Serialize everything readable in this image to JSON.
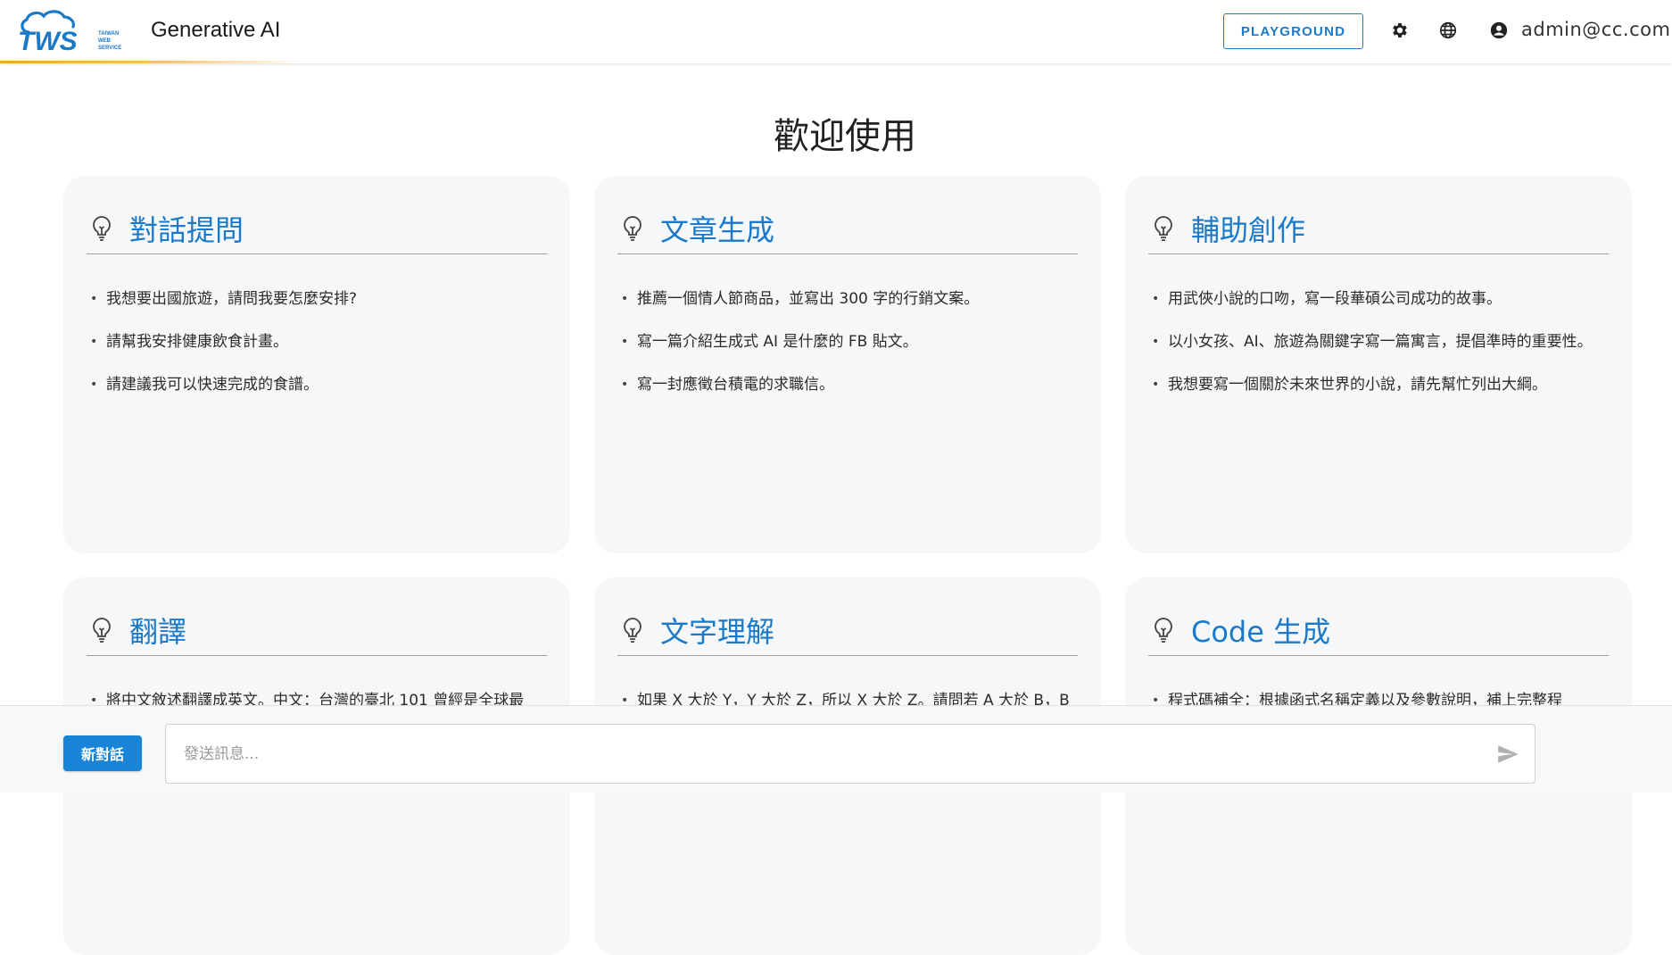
{
  "header": {
    "logo_text": "TWS",
    "logo_subtext": [
      "TAIWAN",
      "WEB",
      "SERVICE"
    ],
    "title": "Generative AI",
    "playground_label": "PLAYGROUND",
    "user_email": "admin@cc.com",
    "icons": [
      "settings-icon",
      "globe-icon",
      "account-circle-icon"
    ]
  },
  "main": {
    "welcome": "歡迎使用",
    "cards": [
      {
        "title": "對話提問",
        "icon": "lightbulb-icon",
        "items": [
          "我想要出國旅遊，請問我要怎麼安排?",
          "請幫我安排健康飲食計畫。",
          "請建議我可以快速完成的食譜。"
        ]
      },
      {
        "title": "文章生成",
        "icon": "lightbulb-icon",
        "items": [
          "推薦一個情人節商品，並寫出 300 字的行銷文案。",
          "寫一篇介紹生成式 AI 是什麼的 FB 貼文。",
          "寫一封應徵台積電的求職信。"
        ]
      },
      {
        "title": "輔助創作",
        "icon": "lightbulb-icon",
        "items": [
          "用武俠小說的口吻，寫一段華碩公司成功的故事。",
          "以小女孩、AI、旅遊為關鍵字寫一篇寓言，提倡準時的重要性。",
          "我想要寫一個關於未來世界的小說，請先幫忙列出大綱。"
        ]
      },
      {
        "title": "翻譯",
        "icon": "lightbulb-icon",
        "items": [
          "將中文敘述翻譯成英文。中文：台灣的臺北 101 曾經是全球最"
        ]
      },
      {
        "title": "文字理解",
        "icon": "lightbulb-icon",
        "items": [
          "如果 X 大於 Y，Y 大於 Z，所以 X 大於 Z。請問若 A 大於 B，B"
        ]
      },
      {
        "title": "Code 生成",
        "icon": "lightbulb-icon",
        "items": [
          "程式碼補全：根據函式名稱定義以及參數說明，補上完整程"
        ]
      }
    ]
  },
  "footer": {
    "new_chat_label": "新對話",
    "input_placeholder": "發送訊息...",
    "input_value": "",
    "send_icon": "send-icon"
  },
  "colors": {
    "accent": "#1a7ac9",
    "button_bg": "#1a84d6",
    "header_underline": "#f5a623",
    "card_bg": "#f6f7f9"
  }
}
